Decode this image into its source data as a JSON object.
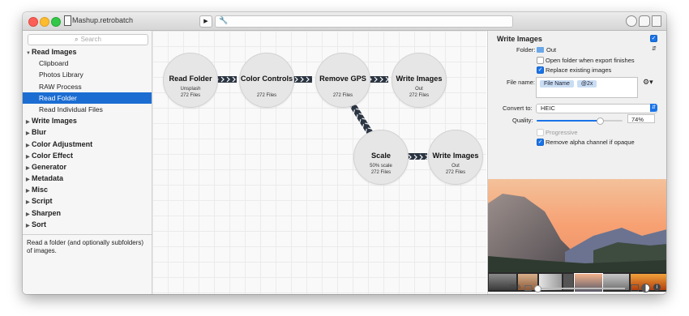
{
  "window": {
    "title": "Mashup.retrobatch"
  },
  "toolbar": {
    "play_icon": "play-icon",
    "play_glyph": "▶",
    "status_text": "",
    "wrench_glyph": "🔧"
  },
  "sidebar": {
    "search_placeholder": "Search",
    "groups": [
      {
        "label": "Read Images",
        "expanded": true,
        "items": [
          "Clipboard",
          "Photos Library",
          "RAW Process",
          "Read Folder",
          "Read Individual Files"
        ],
        "selected": "Read Folder"
      },
      {
        "label": "Write Images"
      },
      {
        "label": "Blur"
      },
      {
        "label": "Color Adjustment"
      },
      {
        "label": "Color Effect"
      },
      {
        "label": "Generator"
      },
      {
        "label": "Metadata"
      },
      {
        "label": "Misc"
      },
      {
        "label": "Script"
      },
      {
        "label": "Sharpen"
      },
      {
        "label": "Sort"
      }
    ],
    "description": "Read a folder (and optionally subfolders) of images."
  },
  "nodes": {
    "read_folder": {
      "title": "Read Folder",
      "subtitle": "Unsplash",
      "files": "272 Files"
    },
    "color_controls": {
      "title": "Color Controls",
      "subtitle": "",
      "files": "272 Files"
    },
    "remove_gps": {
      "title": "Remove GPS",
      "subtitle": "",
      "files": "272 Files"
    },
    "write_images_1": {
      "title": "Write Images",
      "subtitle": "Out",
      "files": "272 Files"
    },
    "scale": {
      "title": "Scale",
      "subtitle": "50% scale",
      "files": "272 Files"
    },
    "write_images_2": {
      "title": "Write Images",
      "subtitle": "Out",
      "files": "272 Files"
    }
  },
  "inspector": {
    "title": "Write Images",
    "enabled": true,
    "folder_label": "Folder:",
    "folder_value": "Out",
    "open_folder_label": "Open folder when export finishes",
    "open_folder_checked": false,
    "replace_label": "Replace existing images",
    "replace_checked": true,
    "file_name_label": "File name:",
    "file_name_tokens": [
      "File Name",
      "@2x"
    ],
    "convert_to_label": "Convert to:",
    "convert_to_value": "HEIC",
    "quality_label": "Quality:",
    "quality_value": "74%",
    "quality_fraction": 0.74,
    "progressive_label": "Progressive",
    "progressive_checked": false,
    "remove_alpha_label": "Remove alpha channel if opaque",
    "remove_alpha_checked": true
  },
  "preview": {
    "zoom": "15%"
  },
  "colors": {
    "accent": "#1b6dd2",
    "node_fill": "#e6e6e6",
    "connector": "#2b3542"
  }
}
